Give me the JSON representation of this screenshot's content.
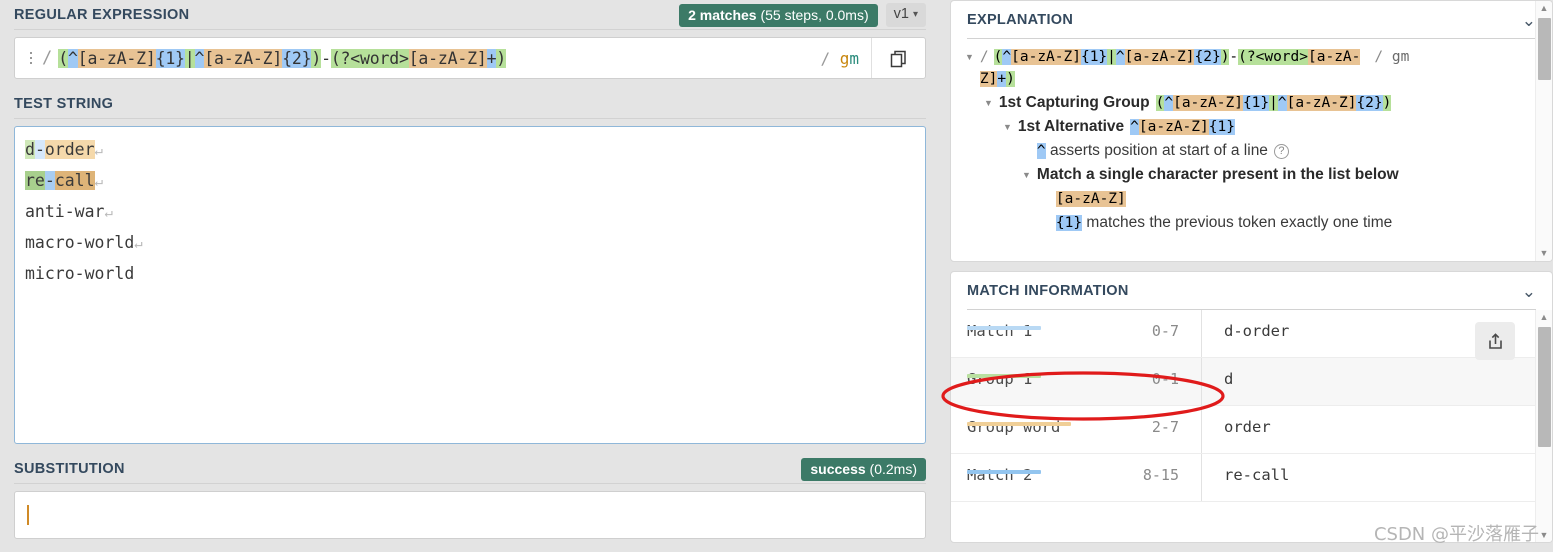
{
  "left": {
    "regex_section": {
      "title": "REGULAR EXPRESSION",
      "match_badge_count": "2 matches",
      "match_badge_detail": " (55 steps, 0.0ms)",
      "version_label": "v1",
      "caret_icon": "chevron-down-icon",
      "delimiter": "/",
      "flags_slash": "/",
      "flag_g": "g",
      "flag_m": "m",
      "pattern_plain": "(^[a-zA-Z]{1}|^[a-zA-Z]{2})-(?<word>[a-zA-Z]+)",
      "pattern_tokens": [
        {
          "t": "(",
          "c": "t-grp"
        },
        {
          "t": "^",
          "c": "t-blue"
        },
        {
          "t": "[a-zA-Z]",
          "c": "t-tan"
        },
        {
          "t": "{1}",
          "c": "t-blue"
        },
        {
          "t": "|",
          "c": "t-grp"
        },
        {
          "t": "^",
          "c": "t-blue"
        },
        {
          "t": "[a-zA-Z]",
          "c": "t-tan"
        },
        {
          "t": "{2}",
          "c": "t-blue"
        },
        {
          "t": ")",
          "c": "t-grp"
        },
        {
          "t": "-",
          "c": "t-none"
        },
        {
          "t": "(?<word>",
          "c": "t-grp"
        },
        {
          "t": "[a-zA-Z]",
          "c": "t-tan"
        },
        {
          "t": "+",
          "c": "t-blue"
        },
        {
          "t": ")",
          "c": "t-grp"
        }
      ],
      "copy_icon": "copy-icon",
      "grip_icon": "drag-handle-icon"
    },
    "test_section": {
      "title": "TEST STRING",
      "lines": [
        {
          "segments": [
            {
              "t": "d",
              "c": "m1a"
            },
            {
              "t": "-",
              "c": "m1b"
            },
            {
              "t": "order",
              "c": "m1c"
            }
          ],
          "pilcrow": "↵"
        },
        {
          "segments": [
            {
              "t": "re",
              "c": "m2a"
            },
            {
              "t": "-",
              "c": "m2b"
            },
            {
              "t": "call",
              "c": "m2c"
            }
          ],
          "pilcrow": "↵"
        },
        {
          "segments": [
            {
              "t": "anti-war",
              "c": ""
            }
          ],
          "pilcrow": "↵"
        },
        {
          "segments": [
            {
              "t": "macro-world",
              "c": ""
            }
          ],
          "pilcrow": "↵"
        },
        {
          "segments": [
            {
              "t": "micro-world",
              "c": ""
            }
          ],
          "pilcrow": ""
        }
      ]
    },
    "subst_section": {
      "title": "SUBSTITUTION",
      "status_text": "success",
      "status_detail": " (0.2ms)",
      "value": "",
      "placeholder": ""
    }
  },
  "right": {
    "explanation": {
      "title": "EXPLANATION",
      "collapse_icon": "chevron-down-icon",
      "rows": [
        {
          "kind": "regex-wrap",
          "indent": 0,
          "has_tri": true,
          "prefix": "/",
          "suffix_slash": "/",
          "suffix_flags": "gm",
          "tokens": [
            {
              "t": "(",
              "c": "t-grp"
            },
            {
              "t": "^",
              "c": "t-blue"
            },
            {
              "t": "[a-zA-Z]",
              "c": "t-tan"
            },
            {
              "t": "{1}",
              "c": "t-blue"
            },
            {
              "t": "|",
              "c": "t-grp"
            },
            {
              "t": "^",
              "c": "t-blue"
            },
            {
              "t": "[a-zA-Z]",
              "c": "t-tan"
            },
            {
              "t": "{2}",
              "c": "t-blue"
            },
            {
              "t": ")",
              "c": "t-grp"
            },
            {
              "t": "-",
              "c": "t-none"
            },
            {
              "t": "(?<word>",
              "c": "t-grp"
            },
            {
              "t": "[a-zA-",
              "c": "t-tan"
            }
          ],
          "tokens2": [
            {
              "t": "Z]",
              "c": "t-tan"
            },
            {
              "t": "+",
              "c": "t-blue"
            },
            {
              "t": ")",
              "c": "t-grp"
            }
          ]
        },
        {
          "kind": "node",
          "indent": 1,
          "has_tri": true,
          "label": "1st Capturing Group",
          "tokens": [
            {
              "t": "(",
              "c": "t-grp"
            },
            {
              "t": "^",
              "c": "t-blue"
            },
            {
              "t": "[a-zA-Z]",
              "c": "t-tan"
            },
            {
              "t": "{1}",
              "c": "t-blue"
            },
            {
              "t": "|",
              "c": "t-grp"
            },
            {
              "t": "^",
              "c": "t-blue"
            },
            {
              "t": "[a-zA-Z]",
              "c": "t-tan"
            },
            {
              "t": "{2}",
              "c": "t-blue"
            },
            {
              "t": ")",
              "c": "t-grp"
            }
          ]
        },
        {
          "kind": "node",
          "indent": 2,
          "has_tri": true,
          "label": "1st Alternative",
          "tokens": [
            {
              "t": "^",
              "c": "t-blue"
            },
            {
              "t": "[a-zA-Z]",
              "c": "t-tan"
            },
            {
              "t": "{1}",
              "c": "t-blue"
            }
          ]
        },
        {
          "kind": "desc",
          "indent": 3,
          "has_tri": false,
          "tokens": [
            {
              "t": "^",
              "c": "t-blue"
            }
          ],
          "text": "asserts position at start of a line",
          "help_icon": "help-icon"
        },
        {
          "kind": "node",
          "indent": 3,
          "has_tri": true,
          "label": "Match a single character present in the list below",
          "tokens": []
        },
        {
          "kind": "tokens-only",
          "indent": 4,
          "has_tri": false,
          "tokens": [
            {
              "t": "[a-zA-Z]",
              "c": "t-tan"
            }
          ]
        },
        {
          "kind": "desc",
          "indent": 4,
          "has_tri": false,
          "tokens": [
            {
              "t": "{1}",
              "c": "t-blue"
            }
          ],
          "text": "matches the previous token exactly one time",
          "help_icon": ""
        }
      ]
    },
    "match_info": {
      "title": "MATCH INFORMATION",
      "collapse_icon": "chevron-down-icon",
      "export_icon": "export-icon",
      "rows": [
        {
          "label": "Match 1",
          "range": "0-7",
          "value": "d-order",
          "uline": "u-blue1",
          "uwidth": 74,
          "alt": false
        },
        {
          "label": "Group 1",
          "range": "0-1",
          "value": "d",
          "uline": "u-green",
          "uwidth": 74,
          "alt": true
        },
        {
          "label": "Group word",
          "range": "2-7",
          "value": "order",
          "uline": "u-tan",
          "uwidth": 104,
          "alt": false
        },
        {
          "label": "Match 2",
          "range": "8-15",
          "value": "re-call",
          "uline": "u-blue2",
          "uwidth": 74,
          "alt": false
        }
      ]
    }
  },
  "watermark": "CSDN @平沙落雁子",
  "colors": {
    "accent_green": "#3c7a67",
    "page_bg": "#e4e4e4",
    "title_text": "#34495e",
    "annotation_red": "#e01b1b",
    "group_green": "#b6e09a",
    "token_blue": "#9fc9f5",
    "token_tan": "#e8c394"
  }
}
